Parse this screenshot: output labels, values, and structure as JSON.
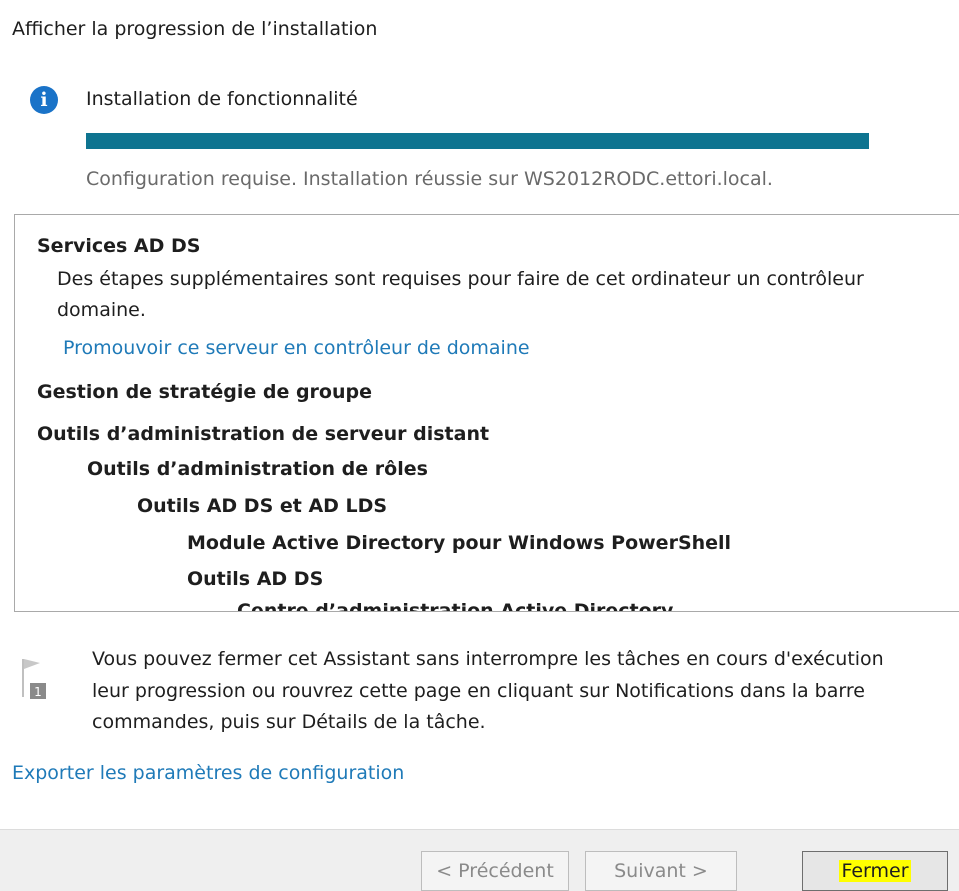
{
  "page": {
    "title": "Afficher la progression de l’installation"
  },
  "status": {
    "icon": "info-icon",
    "heading": "Installation de fonctionnalité",
    "progress_percent": 100,
    "progress_color": "#0e7490",
    "message": "Configuration requise. Installation réussie sur WS2012RODC.ettori.local."
  },
  "results": {
    "ad_ds": {
      "title": "Services AD DS",
      "desc_line1": "Des étapes supplémentaires sont requises pour faire de cet ordinateur un contrôleur",
      "desc_line2": "domaine.",
      "link": "Promouvoir ce serveur en contrôleur de domaine"
    },
    "gpm": {
      "title": "Gestion de stratégie de groupe"
    },
    "rsat": {
      "title": "Outils d’administration de serveur distant",
      "roles": "Outils d’administration de rôles",
      "adds_adlds": "Outils AD DS et AD LDS",
      "ps_module": "Module Active Directory pour Windows PowerShell",
      "adds_tools": "Outils AD DS",
      "adac": "Centre d’administration Active Directory"
    }
  },
  "note": {
    "icon": "flag-icon",
    "line1": "Vous pouvez fermer cet Assistant sans interrompre les tâches en cours d'exécution",
    "line2": "leur progression ou rouvrez cette page en cliquant sur Notifications dans la barre",
    "line3": "commandes, puis sur Détails de la tâche."
  },
  "export_link": "Exporter les paramètres de configuration",
  "buttons": {
    "previous": "< Précédent",
    "next": "Suivant >",
    "close": "Fermer"
  }
}
